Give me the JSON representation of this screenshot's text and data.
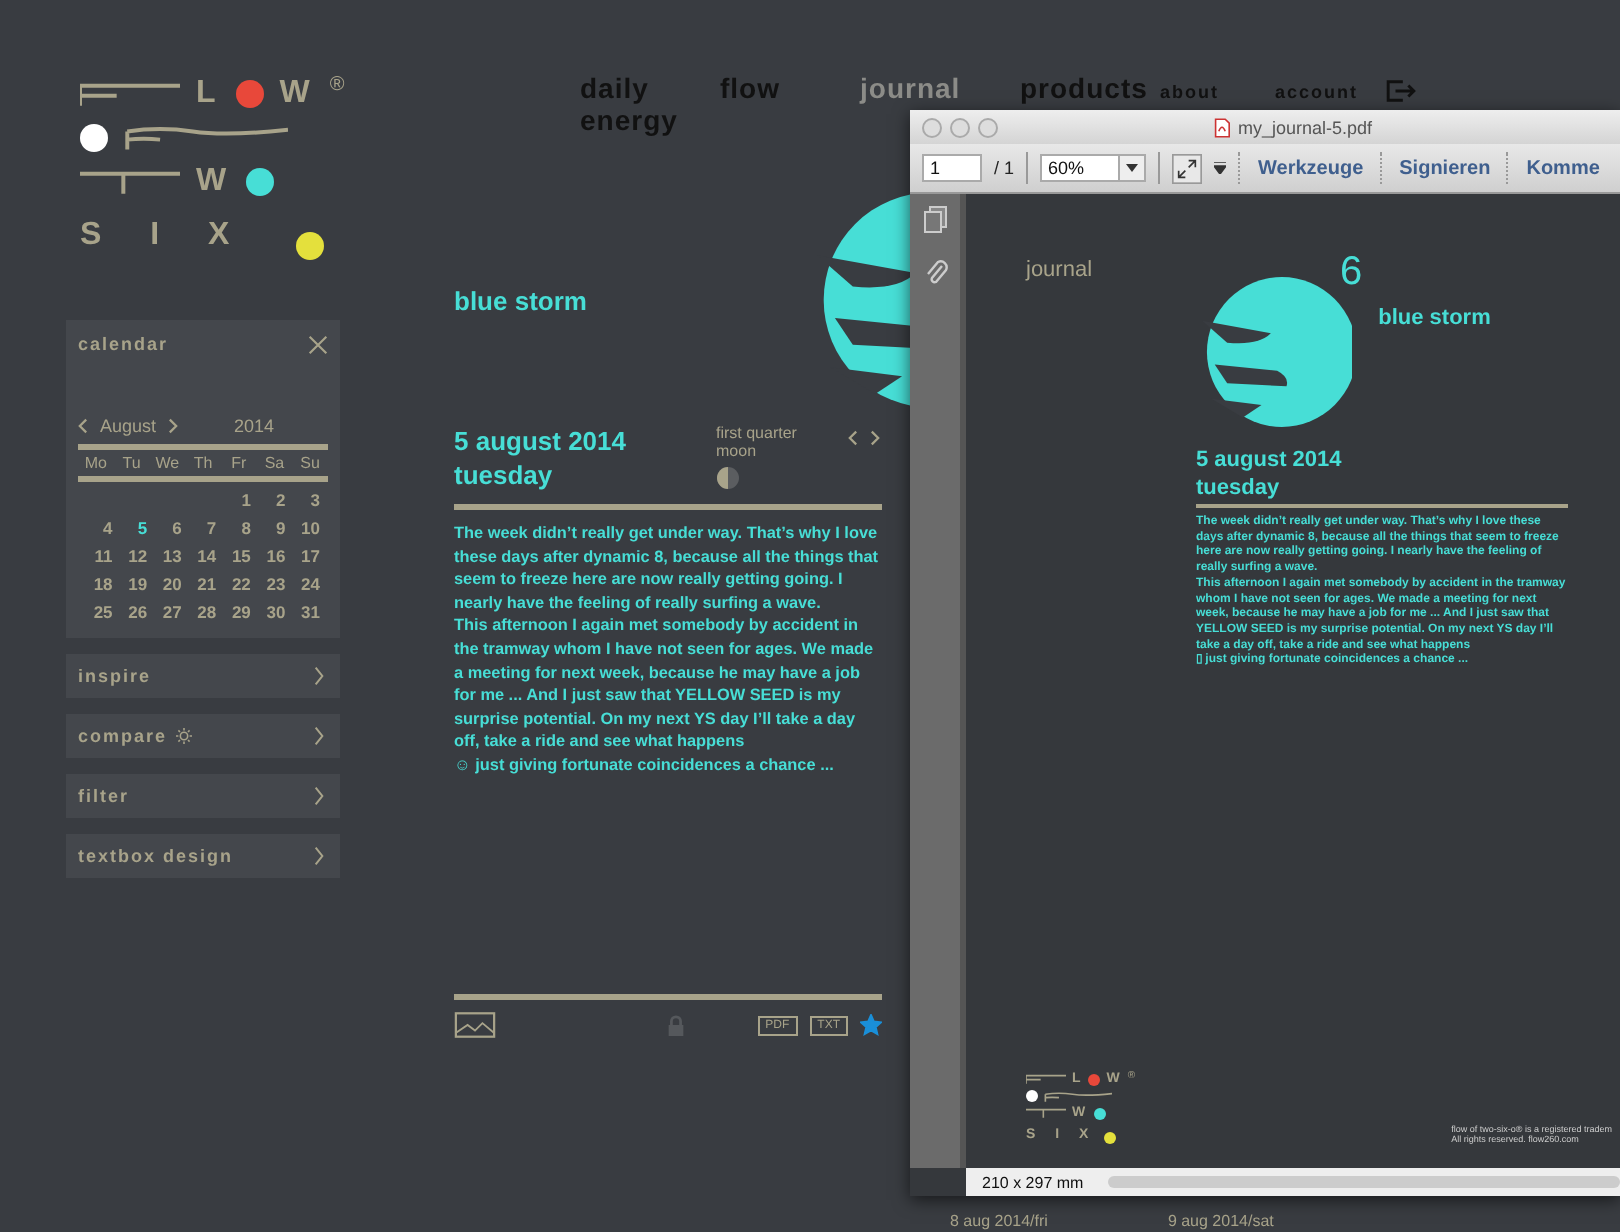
{
  "logo": {
    "letters": [
      "L",
      "W",
      "W",
      "S I X"
    ],
    "registered": "®"
  },
  "nav": [
    {
      "label": "daily energy",
      "selected": false
    },
    {
      "label": "flow",
      "selected": false
    },
    {
      "label": "journal",
      "selected": true
    },
    {
      "label": "products",
      "selected": false
    }
  ],
  "top_links": [
    "about",
    "account"
  ],
  "calendar": {
    "title": "calendar",
    "month": "August",
    "year": "2014",
    "weekdays": [
      "Mo",
      "Tu",
      "We",
      "Th",
      "Fr",
      "Sa",
      "Su"
    ],
    "weeks": [
      [
        {
          "d": "1",
          "selected": false
        },
        {
          "d": "2",
          "selected": false
        },
        {
          "d": "3",
          "selected": false
        }
      ],
      [
        {
          "d": "4",
          "selected": false
        },
        {
          "d": "5",
          "selected": true
        },
        {
          "d": "6",
          "selected": false
        },
        {
          "d": "7",
          "selected": false
        },
        {
          "d": "8",
          "selected": false
        },
        {
          "d": "9",
          "selected": false
        },
        {
          "d": "10",
          "selected": false
        }
      ],
      [
        {
          "d": "11",
          "selected": false
        },
        {
          "d": "12",
          "selected": false
        },
        {
          "d": "13",
          "selected": false
        },
        {
          "d": "14",
          "selected": false
        },
        {
          "d": "15",
          "selected": false
        },
        {
          "d": "16",
          "selected": false
        },
        {
          "d": "17",
          "selected": false
        }
      ],
      [
        {
          "d": "18",
          "selected": false
        },
        {
          "d": "19",
          "selected": false
        },
        {
          "d": "20",
          "selected": false
        },
        {
          "d": "21",
          "selected": false
        },
        {
          "d": "22",
          "selected": false
        },
        {
          "d": "23",
          "selected": false
        },
        {
          "d": "24",
          "selected": false
        }
      ],
      [
        {
          "d": "25",
          "selected": false
        },
        {
          "d": "26",
          "selected": false
        },
        {
          "d": "27",
          "selected": false
        },
        {
          "d": "28",
          "selected": false
        },
        {
          "d": "29",
          "selected": false
        },
        {
          "d": "30",
          "selected": false
        },
        {
          "d": "31",
          "selected": false
        }
      ]
    ]
  },
  "panels": [
    {
      "label": "inspire",
      "kind": "plain"
    },
    {
      "label": "compare",
      "kind": "sun"
    },
    {
      "label": "filter",
      "kind": "plain"
    },
    {
      "label": "textbox design",
      "kind": "plain"
    }
  ],
  "entry": {
    "title": "blue storm",
    "date": "5 august 2014",
    "weekday": "tuesday",
    "moon": "first quarter moon",
    "paragraphs": [
      "The week didn’t really get under way. That’s why I love these days after dynamic 8, because all the things that seem to freeze here are now really getting going. I nearly have the feeling of really surfing a wave.",
      "This afternoon I again met somebody by accident in the tramway whom I have not seen for ages. We made a meeting for next week, because he may have a job for me ... And I just saw that YELLOW SEED is my surprise potential. On my next YS day I’ll take a day off, take a ride and see what happens",
      "☺ just giving fortunate coincidences a chance ..."
    ],
    "exports": [
      "PDF",
      "TXT"
    ],
    "favorite": true
  },
  "strip": [
    "8 aug 2014/fri",
    "9 aug 2014/sat"
  ],
  "pdf": {
    "title": "my_journal-5.pdf",
    "page": "1",
    "pages": "/ 1",
    "zoom": "60%",
    "tools": [
      "Werkzeuge",
      "Signieren",
      "Komme"
    ],
    "heading": "journal",
    "number": "6",
    "title2": "blue storm",
    "date": "5 august 2014",
    "weekday": "tuesday",
    "paragraphs": [
      "The week didn’t really get under way. That’s why I love these days after dynamic 8, because all the things that seem to freeze here are now really getting going. I nearly have the feeling of really surfing a wave.",
      "This afternoon I again met somebody by accident in the tramway whom I have not seen for ages. We made a meeting for next week, because he may have a job for me ... And I just saw that YELLOW SEED is my surprise potential. On my next YS day I’ll take a day off, take a ride and see what happens",
      "▯ just giving fortunate coincidences a chance ..."
    ],
    "logo": {
      "letters": [
        "L",
        "W",
        "W",
        "S I X"
      ],
      "registered": "®"
    },
    "footer": [
      "flow of two-six-o® is a registered tradem",
      "All rights reserved. flow260.com"
    ],
    "size": "210 x 297 mm"
  }
}
